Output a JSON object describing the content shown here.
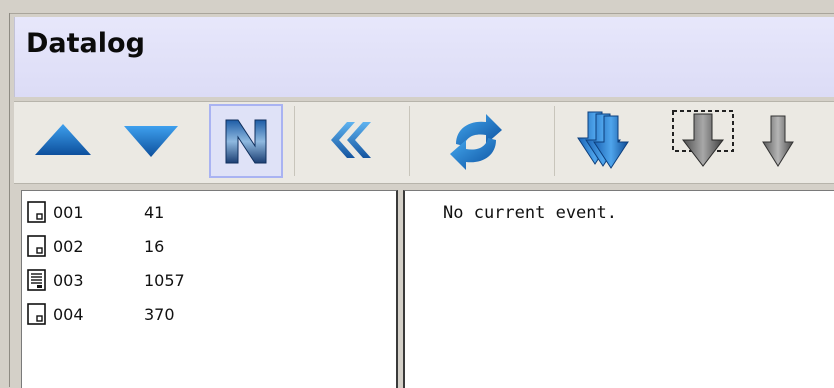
{
  "panel": {
    "title": "Datalog"
  },
  "toolbar": {
    "buttons": [
      {
        "icon": "arrow-up-icon",
        "active": false
      },
      {
        "icon": "arrow-down-icon",
        "active": false
      },
      {
        "icon": "n-icon",
        "active": true
      },
      {
        "icon": "double-chevron-left-icon",
        "active": false
      },
      {
        "icon": "refresh-icon",
        "active": false
      },
      {
        "icon": "multi-down-arrow-icon",
        "active": false
      },
      {
        "icon": "selection-down-arrow-icon",
        "active": false
      },
      {
        "icon": "gray-down-arrow-icon",
        "active": false
      }
    ]
  },
  "datalog_list": {
    "items": [
      {
        "id": "001",
        "count": "41",
        "icon": "page-icon"
      },
      {
        "id": "002",
        "count": "16",
        "icon": "page-icon"
      },
      {
        "id": "003",
        "count": "1057",
        "icon": "document-lines-icon"
      },
      {
        "id": "004",
        "count": "370",
        "icon": "page-icon"
      }
    ]
  },
  "event_view": {
    "text": "No current event."
  },
  "colors": {
    "header_bg": "#e3e3f9",
    "toolbar_bg": "#ebe9e3",
    "blue_icon": "#1f72c4",
    "gray_icon": "#6f6f6f",
    "active_border": "#a9b3f2"
  }
}
